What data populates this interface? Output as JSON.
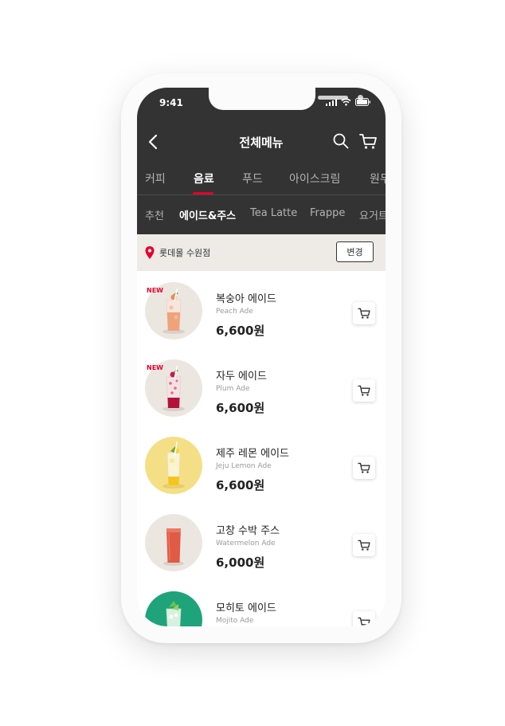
{
  "status": {
    "time": "9:41"
  },
  "header": {
    "title": "전체메뉴"
  },
  "tabs": [
    {
      "label": "커피"
    },
    {
      "label": "음료"
    },
    {
      "label": "푸드"
    },
    {
      "label": "아이스크림"
    },
    {
      "label": "원두"
    }
  ],
  "subtabs": [
    {
      "label": "추천"
    },
    {
      "label": "에이드&주스"
    },
    {
      "label": "Tea Latte"
    },
    {
      "label": "Frappe"
    },
    {
      "label": "요거트"
    }
  ],
  "store": {
    "name": "롯데몰 수원점",
    "change_label": "변경"
  },
  "colors": {
    "accent": "#e4002b",
    "header_bg": "#333333",
    "store_bg": "#eeebe7"
  },
  "items": [
    {
      "badge": "NEW",
      "name": "복숭아 에이드",
      "english": "Peach Ade",
      "price": "6,600원"
    },
    {
      "badge": "NEW",
      "name": "자두 에이드",
      "english": "Plum Ade",
      "price": "6,600원"
    },
    {
      "badge": "",
      "name": "제주 레몬 에이드",
      "english": "Jeju Lemon Ade",
      "price": "6,600원"
    },
    {
      "badge": "",
      "name": "고창 수박 주스",
      "english": "Watermelon Ade",
      "price": "6,000원"
    },
    {
      "badge": "",
      "name": "모히토 에이드",
      "english": "Mojito Ade",
      "price": ""
    }
  ]
}
